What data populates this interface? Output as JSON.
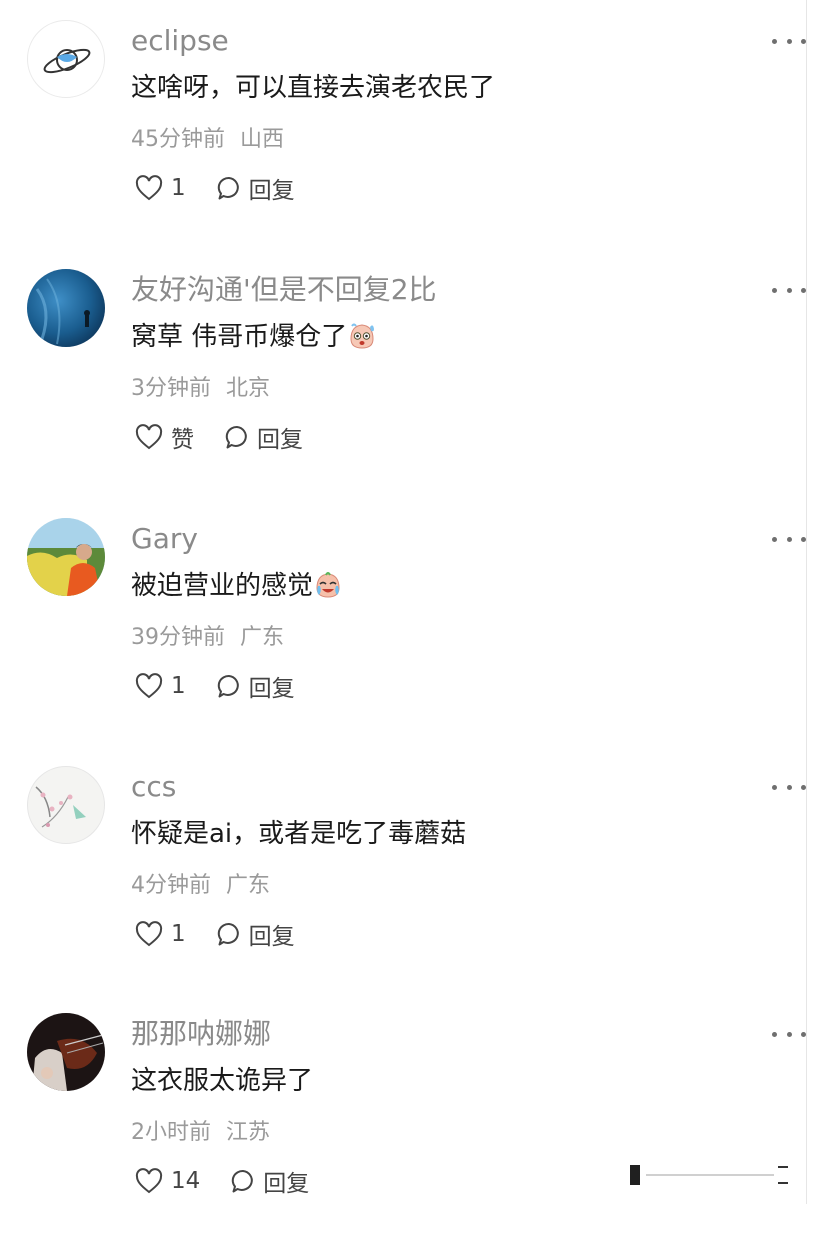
{
  "comments": [
    {
      "username": "eclipse",
      "text": "这啥呀，可以直接去演老农民了",
      "time": "45分钟前",
      "location": "山西",
      "likes": "1",
      "reply": "回复"
    },
    {
      "username": "友好沟通'但是不回复2比",
      "text": "窝草 伟哥币爆仓了",
      "time": "3分钟前",
      "location": "北京",
      "likes": "赞",
      "reply": "回复"
    },
    {
      "username": "Gary",
      "text": "被迫营业的感觉",
      "time": "39分钟前",
      "location": "广东",
      "likes": "1",
      "reply": "回复"
    },
    {
      "username": "ccs",
      "text": "怀疑是ai，或者是吃了毒蘑菇",
      "time": "4分钟前",
      "location": "广东",
      "likes": "1",
      "reply": "回复"
    },
    {
      "username": "那那呐娜娜",
      "text": "这衣服太诡异了",
      "time": "2小时前",
      "location": "江苏",
      "likes": "14",
      "reply": "回复"
    }
  ],
  "icons": {
    "like": "heart-outline-icon",
    "reply": "speech-bubble-icon",
    "more": "three-dots-icon"
  },
  "colors": {
    "username": "#8a8a8a",
    "text": "#1a1a1a",
    "meta": "#9a9a9a",
    "action": "#444444"
  }
}
